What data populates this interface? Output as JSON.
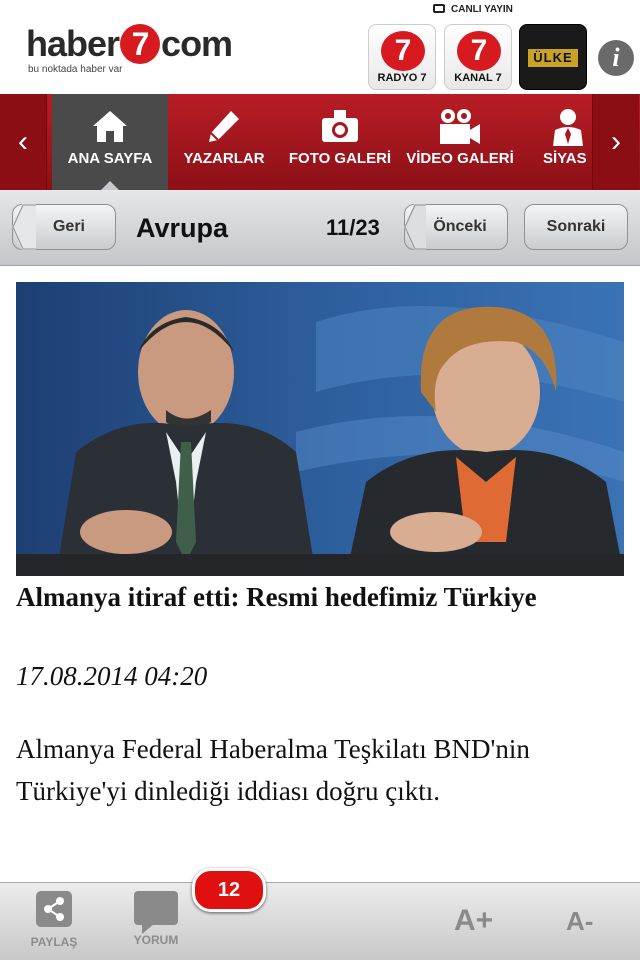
{
  "header": {
    "logo_left": "haber",
    "logo_seven": "7",
    "logo_right": "com",
    "logo_tagline": "bu noktada haber var",
    "live_label": "CANLI YAYIN",
    "channels": [
      {
        "label": "RADYO 7",
        "mark": "7"
      },
      {
        "label": "KANAL 7",
        "mark": "7"
      },
      {
        "label": "ÜLKE",
        "mark": ""
      }
    ],
    "info_label": "i"
  },
  "nav": {
    "prev_arrow": "‹",
    "next_arrow": "›",
    "items": [
      {
        "label": "ANA SAYFA",
        "icon": "home-icon",
        "active": true
      },
      {
        "label": "YAZARLAR",
        "icon": "pencil-icon",
        "active": false
      },
      {
        "label": "FOTO GALERİ",
        "icon": "camera-icon",
        "active": false
      },
      {
        "label": "VİDEO GALERİ",
        "icon": "video-camera-icon",
        "active": false
      },
      {
        "label": "SİYAS",
        "icon": "person-icon",
        "active": false
      }
    ]
  },
  "toolbar": {
    "back_label": "Geri",
    "title": "Avrupa",
    "page_indicator": "11/23",
    "prev_label": "Önceki",
    "next_label": "Sonraki"
  },
  "article": {
    "headline": "Almanya itiraf etti: Resmi hedefimiz Türkiye",
    "date": "17.08.2014 04:20",
    "body": "Almanya Federal Haberalma Teşkilatı BND'nin Türkiye'yi dinlediği iddiası doğru çıktı."
  },
  "bottombar": {
    "share_label": "PAYLAŞ",
    "comment_label": "YORUM",
    "comment_count": "12",
    "font_increase": "A+",
    "font_decrease": "A-"
  },
  "colors": {
    "brand_red": "#d71920",
    "nav_bg": "#a8161e",
    "badge_red": "#e01010"
  }
}
